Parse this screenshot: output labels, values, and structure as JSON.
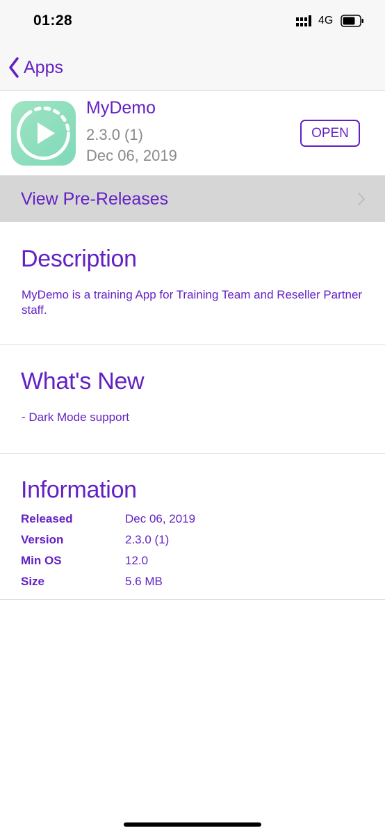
{
  "status_bar": {
    "time": "01:28",
    "network": "4G",
    "signal_icon": "signal-bars-icon",
    "battery_icon": "battery-icon"
  },
  "nav": {
    "back_label": "Apps",
    "back_icon": "chevron-left-icon"
  },
  "app": {
    "name": "MyDemo",
    "version": "2.3.0 (1)",
    "date": "Dec 06, 2019",
    "open_label": "OPEN",
    "icon": "play-circle-icon"
  },
  "pre_releases": {
    "label": "View Pre-Releases",
    "icon": "chevron-right-icon"
  },
  "description": {
    "title": "Description",
    "body": "MyDemo is a training App for Training Team and Reseller Partner staff."
  },
  "whats_new": {
    "title": "What's New",
    "body": "- Dark Mode support"
  },
  "information": {
    "title": "Information",
    "rows": [
      {
        "label": "Released",
        "value": "Dec 06, 2019"
      },
      {
        "label": "Version",
        "value": "2.3.0 (1)"
      },
      {
        "label": "Min OS",
        "value": "12.0"
      },
      {
        "label": "Size",
        "value": "5.6 MB"
      }
    ]
  },
  "colors": {
    "accent": "#6321c4",
    "secondary_text": "#8a8a8a",
    "highlight_row": "#d6d6d6",
    "icon_gradient": "#9fe4c2"
  }
}
